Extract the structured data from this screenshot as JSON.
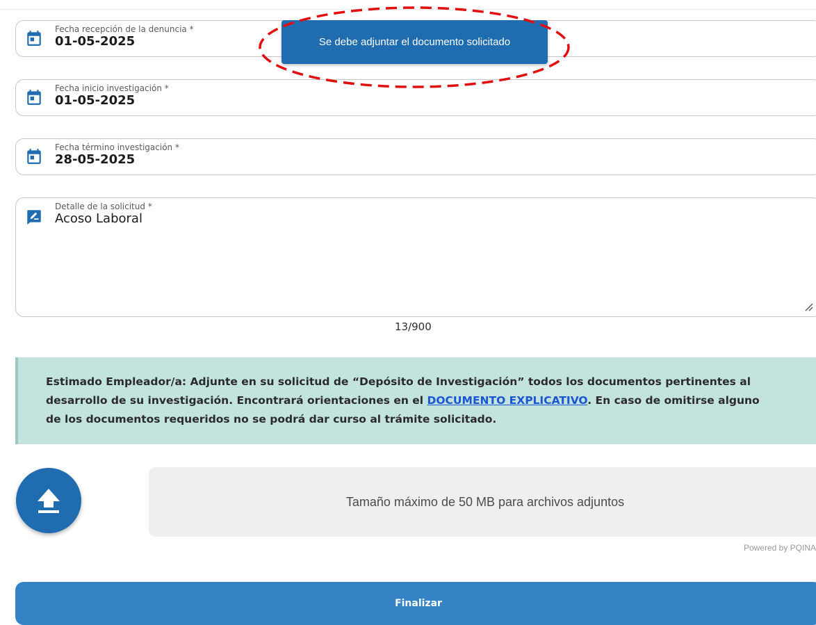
{
  "form": {
    "fecha_recepcion": {
      "label": "Fecha recepción de la denuncia *",
      "value": "01-05-2025"
    },
    "fecha_inicio": {
      "label": "Fecha inicio investigación *",
      "value": "01-05-2025"
    },
    "fecha_termino": {
      "label": "Fecha término investigación *",
      "value": "28-05-2025"
    },
    "detalle": {
      "label": "Detalle de la solicitud *",
      "value": "Acoso Laboral"
    },
    "char_counter": "13/900"
  },
  "tooltip": {
    "message": "Se debe adjuntar el documento solicitado"
  },
  "notice": {
    "line1": "Estimado Empleador/a: Adjunte en su solicitud de “Depósito de Investigación” todos los documentos pertinentes al",
    "line2_before": "desarrollo de su investigación. Encontrará orientaciones en el ",
    "link": "DOCUMENTO EXPLICATIVO",
    "line2_after": ". En caso de omitirse alguno",
    "line3": "de los documentos requeridos no se podrá dar curso al trámite solicitado."
  },
  "upload": {
    "drop_text": "Tamaño máximo de 50 MB para archivos adjuntos",
    "powered_by": "Powered by PQINA"
  },
  "actions": {
    "finalize": "Finalizar"
  },
  "icons": {
    "calendar": "calendar-icon",
    "edit": "edit-note-icon",
    "upload": "upload-icon",
    "resize": "resize-handle-icon"
  },
  "colors": {
    "primary": "#1f6cb0",
    "finalize": "#3582c4",
    "notice_bg": "#c3e3df",
    "link": "#1a56d1",
    "annotation": "#e01010"
  }
}
